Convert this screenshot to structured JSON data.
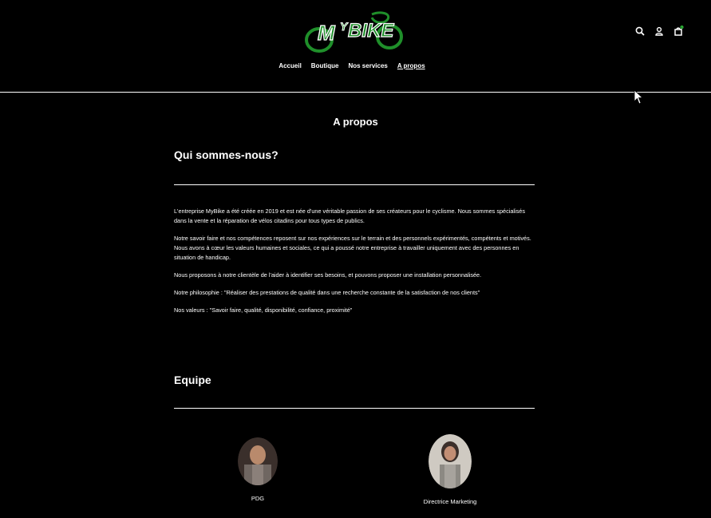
{
  "brand": {
    "logo_text": "MyBIKE",
    "colors": {
      "primary": "#1f8f2a",
      "accent": "#2fbf3a",
      "text": "#ffffff",
      "background": "#000000"
    }
  },
  "nav": {
    "items": [
      {
        "label": "Accueil",
        "active": false
      },
      {
        "label": "Boutique",
        "active": false
      },
      {
        "label": "Nos services",
        "active": false
      },
      {
        "label": "A propos",
        "active": true
      }
    ]
  },
  "header_icons": [
    {
      "name": "search-icon"
    },
    {
      "name": "account-icon"
    },
    {
      "name": "cart-icon",
      "badge": "1"
    }
  ],
  "page": {
    "title": "A propos",
    "about": {
      "heading": "Qui sommes-nous?",
      "paragraphs": [
        "L'entreprise MyBike a été créée en 2019 et est née d'une véritable passion de ses créateurs pour le cyclisme. Nous sommes spécialisés dans la vente et la réparation de vélos citadins pour tous types de publics.",
        "Notre savoir faire et nos compétences reposent sur nos expériences sur le terrain et des personnels expérimentés, compétents et motivés. Nous avons à cœur les valeurs humaines et sociales, ce qui a poussé notre entreprise à travailler uniquement avec des personnes en situation de handicap.",
        "Nous proposons à notre clientèle de l'aider à identifier ses besoins, et pouvons proposer une installation personnalisée.",
        "Notre philosophie : \"Réaliser des prestations de qualité dans une recherche constante de la satisfaction de nos clients\"",
        "Nos valeurs : \"Savoir faire, qualité, disponibilité, confiance, proximité\""
      ]
    },
    "team": {
      "heading": "Equipe",
      "members": [
        {
          "role": "PDG"
        },
        {
          "role": "Directrice Marketing"
        }
      ]
    }
  }
}
